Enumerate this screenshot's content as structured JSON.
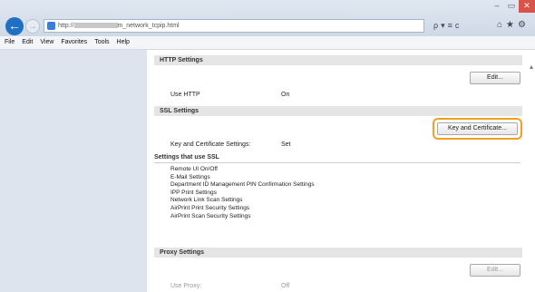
{
  "browser": {
    "url_prefix": "http://",
    "url_suffix": "m_network_tcpip.html",
    "addr_tools": "ρ▾≡c",
    "nav_icons": "⌂★⚙",
    "window_controls": [
      "–",
      "▭",
      "✕"
    ]
  },
  "menu": [
    "File",
    "Edit",
    "View",
    "Favorites",
    "Tools",
    "Help"
  ],
  "http": {
    "header": "HTTP Settings",
    "edit_label": "Edit...",
    "use_label": "Use HTTP",
    "use_value": "On"
  },
  "ssl": {
    "header": "SSL Settings",
    "key_button_label": "Key and Certificate...",
    "key_label": "Key and Certificate Settings:",
    "key_value": "Set",
    "used_by_title": "Settings that use SSL",
    "used_by": [
      "Remote UI On/Off",
      "E-Mail Settings",
      "Department ID Management PIN Confirmation Settings",
      "IPP Print Settings",
      "Network Link Scan Settings",
      "AirPrint Print Security Settings",
      "AirPrint Scan Security Settings"
    ]
  },
  "proxy": {
    "header": "Proxy Settings",
    "edit_label": "Edit...",
    "use_label": "Use Proxy:",
    "use_value": "Off"
  }
}
